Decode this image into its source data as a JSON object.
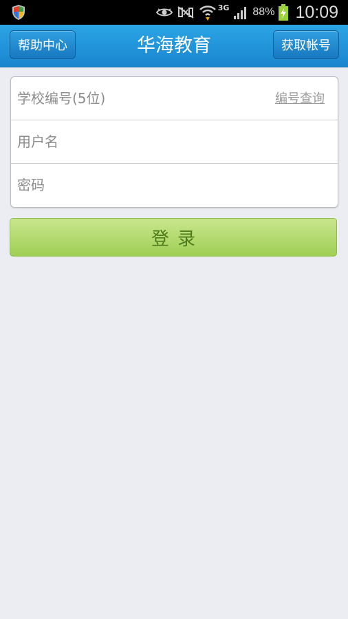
{
  "status_bar": {
    "icons": [
      "shield-icon",
      "eye-icon",
      "nfc-icon",
      "wifi-icon",
      "signal-icon",
      "battery-icon"
    ],
    "network": "3G",
    "battery": "88%",
    "time": "10:09"
  },
  "header": {
    "left_button": "帮助中心",
    "title": "华海教育",
    "right_button": "获取帐号"
  },
  "form": {
    "school_code_placeholder": "学校编号(5位)",
    "school_code_value": "",
    "lookup_link": "编号查询",
    "username_placeholder": "用户名",
    "username_value": "",
    "password_placeholder": "密码",
    "password_value": ""
  },
  "login_button": "登录",
  "colors": {
    "header": "#1e8fd8",
    "login_button": "#b4dc72",
    "login_text": "#4d7a1a",
    "background": "#ebedf2"
  }
}
